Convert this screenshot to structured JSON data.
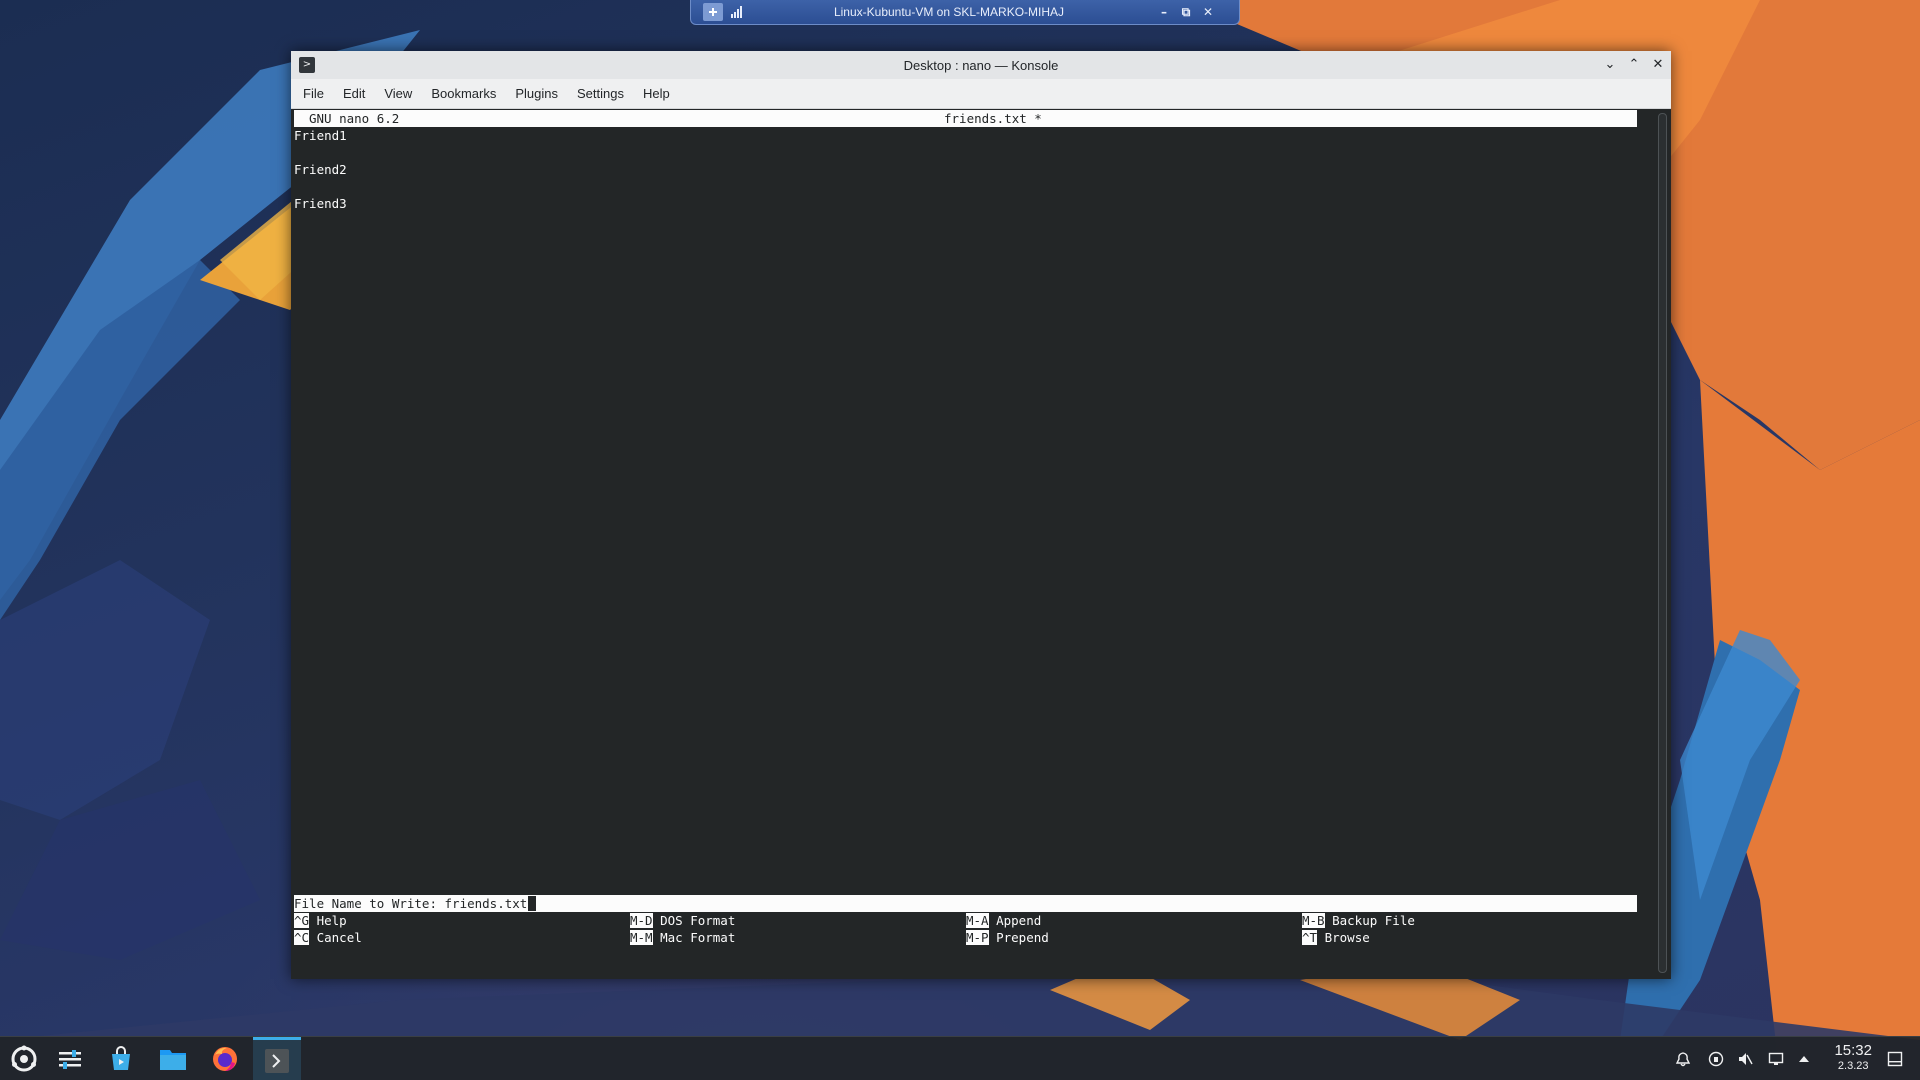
{
  "vm_bar": {
    "title": "Linux-Kubuntu-VM on SKL-MARKO-MIHAJ",
    "minimize": "–",
    "restore": "⧉",
    "close": "✕"
  },
  "window": {
    "title": "Desktop : nano — Konsole",
    "app_icon": ">",
    "btn_minimize": "⌄",
    "btn_maximize": "⌃",
    "btn_close": "✕"
  },
  "menubar": {
    "items": [
      "File",
      "Edit",
      "View",
      "Bookmarks",
      "Plugins",
      "Settings",
      "Help"
    ]
  },
  "nano": {
    "version": "GNU nano 6.2",
    "filename": "friends.txt *",
    "lines": [
      "Friend1",
      "",
      "Friend2",
      "",
      "Friend3"
    ],
    "prompt": "File Name to Write: friends.txt",
    "shortcuts": [
      {
        "key": "^G",
        "label": " Help"
      },
      {
        "key": "M-D",
        "label": " DOS Format"
      },
      {
        "key": "M-A",
        "label": " Append"
      },
      {
        "key": "M-B",
        "label": " Backup File"
      },
      {
        "key": "^C",
        "label": " Cancel"
      },
      {
        "key": "M-M",
        "label": " Mac Format"
      },
      {
        "key": "M-P",
        "label": " Prepend"
      },
      {
        "key": "^T",
        "label": " Browse"
      }
    ]
  },
  "taskbar": {
    "clock_time": "15:32",
    "clock_date": "2.3.23",
    "apps": [
      "application-launcher-icon",
      "system-settings-icon",
      "discover-store-icon",
      "file-manager-icon",
      "firefox-icon",
      "konsole-icon"
    ],
    "tray": [
      "notifications-icon",
      "network-icon",
      "volume-muted-icon",
      "display-icon",
      "tray-expand-icon",
      "show-desktop-icon"
    ]
  },
  "colors": {
    "terminal_bg": "#232627",
    "terminal_fg": "#fcfcfc",
    "accent": "#3daee9"
  }
}
